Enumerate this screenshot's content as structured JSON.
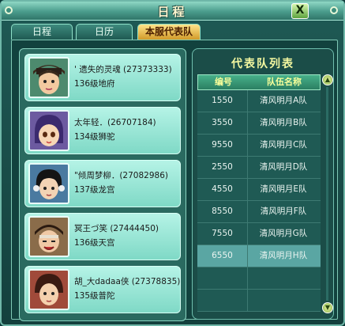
{
  "window": {
    "title": "日程",
    "close_label": "X"
  },
  "tabs": [
    {
      "label": "日程"
    },
    {
      "label": "日历"
    },
    {
      "label": "本服代表队"
    }
  ],
  "members": [
    {
      "name": "' 遗失的灵魂 (27373333)",
      "level": "136级地府"
    },
    {
      "name": "太年轻．(26707184)",
      "level": "134级狮驼"
    },
    {
      "name": "\"倾周梦柳．(27082986)",
      "level": "137级龙宫"
    },
    {
      "name": "冥王づ笑 (27444450)",
      "level": "136级天宫"
    },
    {
      "name": "胡_大dadaa侠 (27378835)",
      "level": "135级普陀"
    }
  ],
  "team_list": {
    "title": "代表队列表",
    "headers": {
      "number": "编号",
      "team_name": "队伍名称"
    },
    "rows": [
      {
        "number": "1550",
        "name": "清风明月A队"
      },
      {
        "number": "3550",
        "name": "清风明月B队"
      },
      {
        "number": "9550",
        "name": "清风明月C队"
      },
      {
        "number": "2550",
        "name": "清风明月D队"
      },
      {
        "number": "4550",
        "name": "清风明月E队"
      },
      {
        "number": "8550",
        "name": "清风明月F队"
      },
      {
        "number": "7550",
        "name": "清风明月G队"
      },
      {
        "number": "6550",
        "name": "清风明月H队"
      }
    ],
    "selected_number": "6550"
  },
  "colors": {
    "accent_gold": "#d19a2a",
    "card": "#b5f3e6",
    "panel": "#1b4d48"
  }
}
